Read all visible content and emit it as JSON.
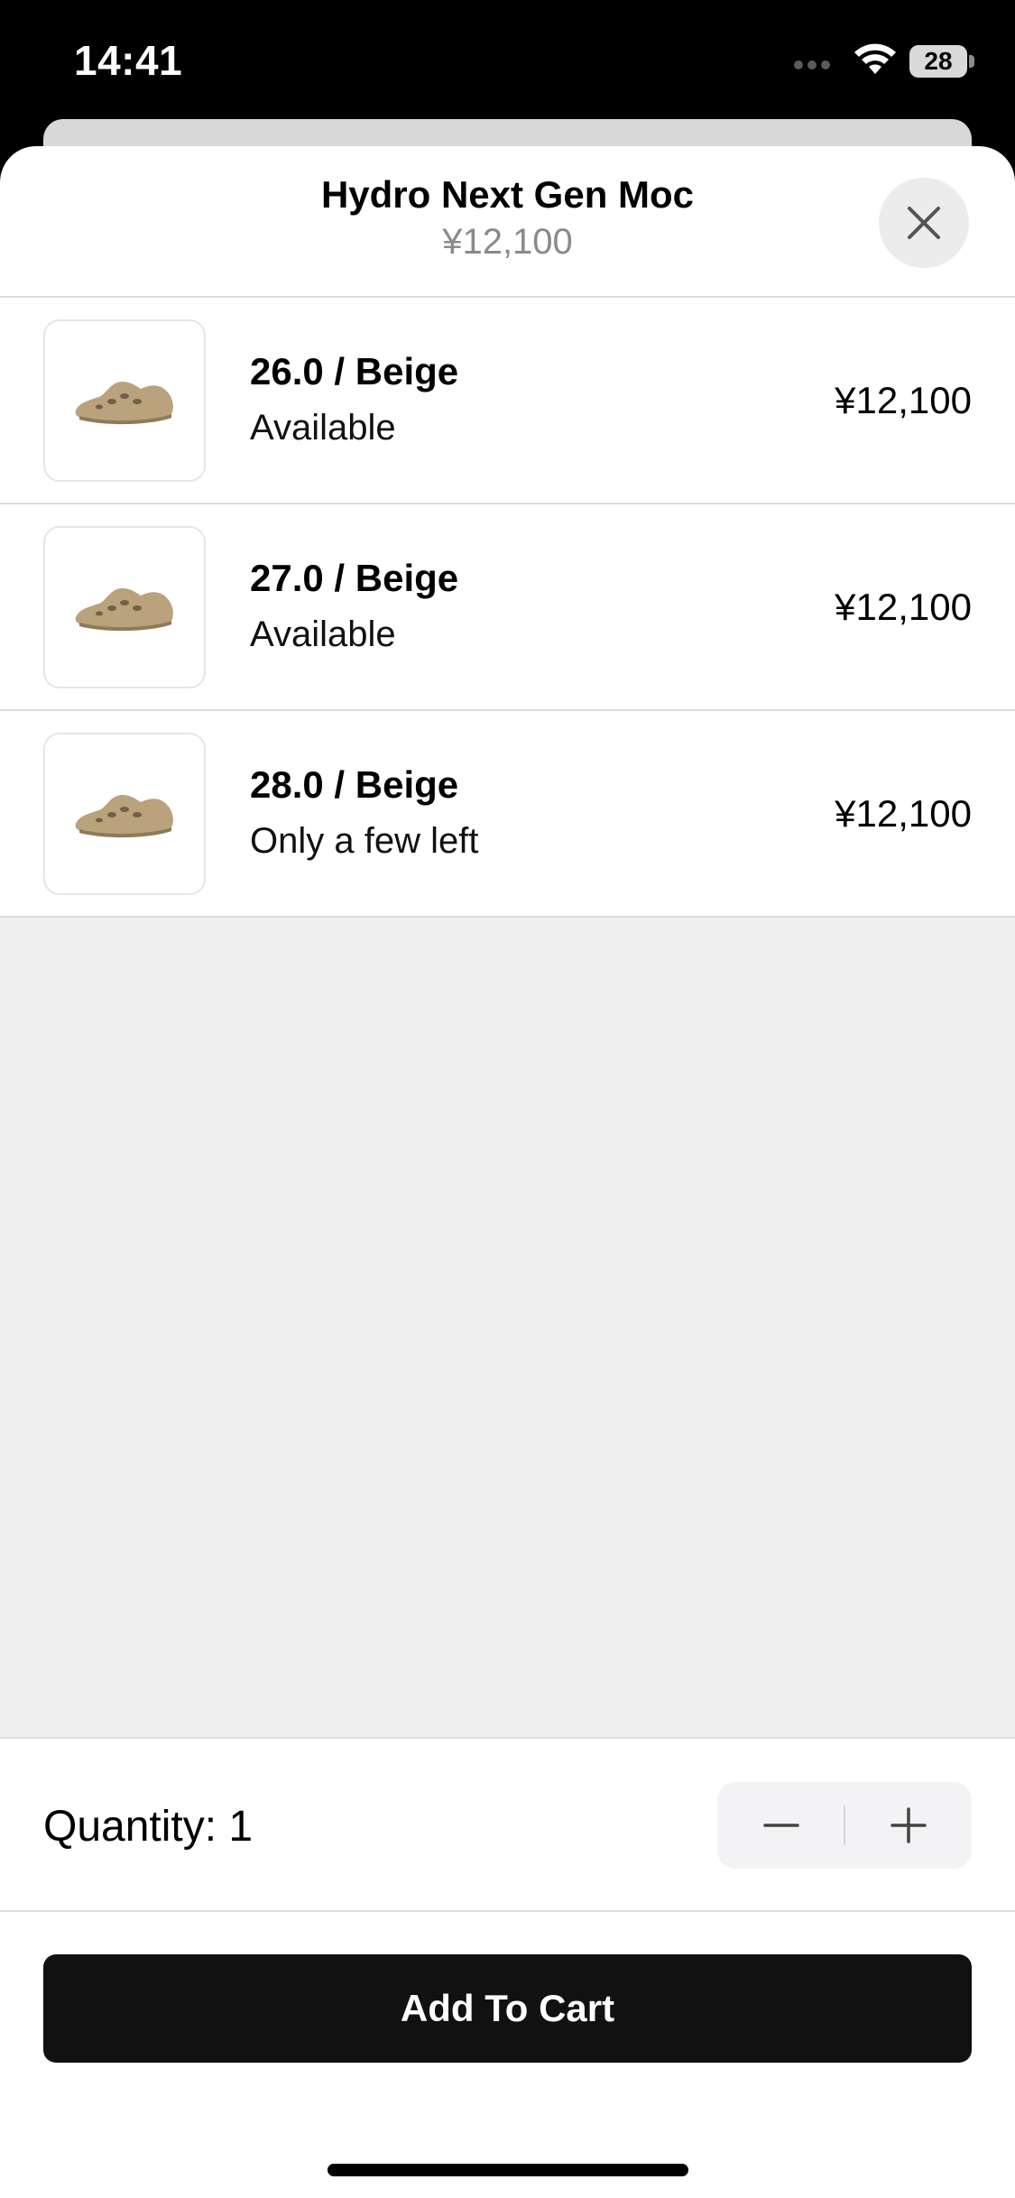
{
  "status_bar": {
    "time": "14:41",
    "battery_level": "28",
    "icons": [
      "signal-dots-icon",
      "wifi-icon",
      "battery-icon"
    ]
  },
  "sheet": {
    "title": "Hydro Next Gen Moc",
    "price": "¥12,100",
    "close_icon": "close-icon"
  },
  "variants": [
    {
      "title": "26.0 / Beige",
      "status": "Available",
      "price": "¥12,100",
      "image": "shoe-thumbnail"
    },
    {
      "title": "27.0 / Beige",
      "status": "Available",
      "price": "¥12,100",
      "image": "shoe-thumbnail"
    },
    {
      "title": "28.0 / Beige",
      "status": "Only a few left",
      "price": "¥12,100",
      "image": "shoe-thumbnail"
    }
  ],
  "quantity": {
    "label": "Quantity: 1",
    "value": 1,
    "decrement_icon": "minus-icon",
    "increment_icon": "plus-icon"
  },
  "actions": {
    "add_to_cart": "Add To Cart"
  },
  "colors": {
    "accent": "#111111",
    "shoe": "#b9a27c",
    "secondary_text": "#8a8a8a",
    "background_fill": "#efefef"
  }
}
